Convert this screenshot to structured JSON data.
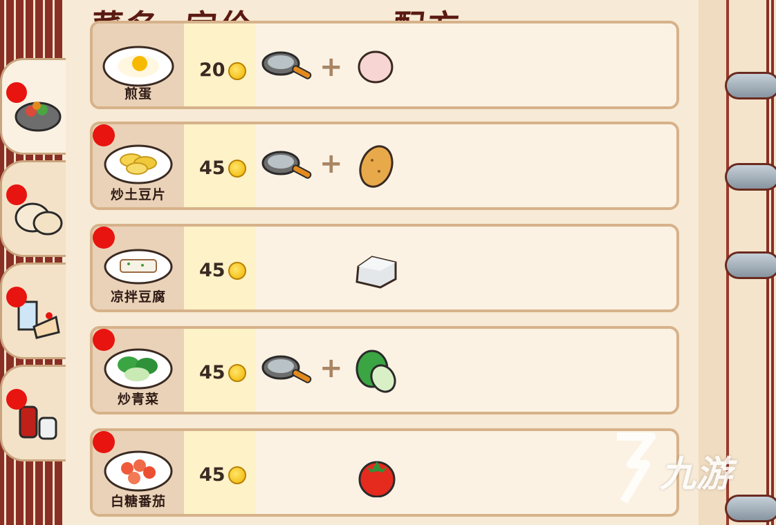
{
  "header": {
    "dish_label": "菜名",
    "price_label": "定价",
    "recipe_label": "配方"
  },
  "rows": [
    {
      "name": "煎蛋",
      "price": "20",
      "new": false,
      "tool": "frying-pan",
      "ingredient": "egg"
    },
    {
      "name": "炒土豆片",
      "price": "45",
      "new": true,
      "tool": "frying-pan",
      "ingredient": "potato"
    },
    {
      "name": "凉拌豆腐",
      "price": "45",
      "new": true,
      "tool": "",
      "ingredient": "tofu"
    },
    {
      "name": "炒青菜",
      "price": "45",
      "new": true,
      "tool": "frying-pan",
      "ingredient": "bok-choy"
    },
    {
      "name": "白糖番茄",
      "price": "45",
      "new": true,
      "tool": "",
      "ingredient": "tomato"
    }
  ],
  "tabs": [
    {
      "name": "hot-dishes",
      "icon": "stir-fry-bowl-icon",
      "new": true,
      "active": true
    },
    {
      "name": "staples",
      "icon": "bun-icon",
      "new": true,
      "active": false
    },
    {
      "name": "desserts",
      "icon": "cake-drink-icon",
      "new": true,
      "active": false
    },
    {
      "name": "condiments",
      "icon": "sauce-bottle-icon",
      "new": true,
      "active": false
    }
  ],
  "plus_symbol": "+",
  "watermark": {
    "text": "九游"
  },
  "colors": {
    "new_dot": "#e8140f",
    "price_bg": "#fdf2c8",
    "dish_bg": "#ead2b8",
    "header_text": "#5a1a12"
  }
}
